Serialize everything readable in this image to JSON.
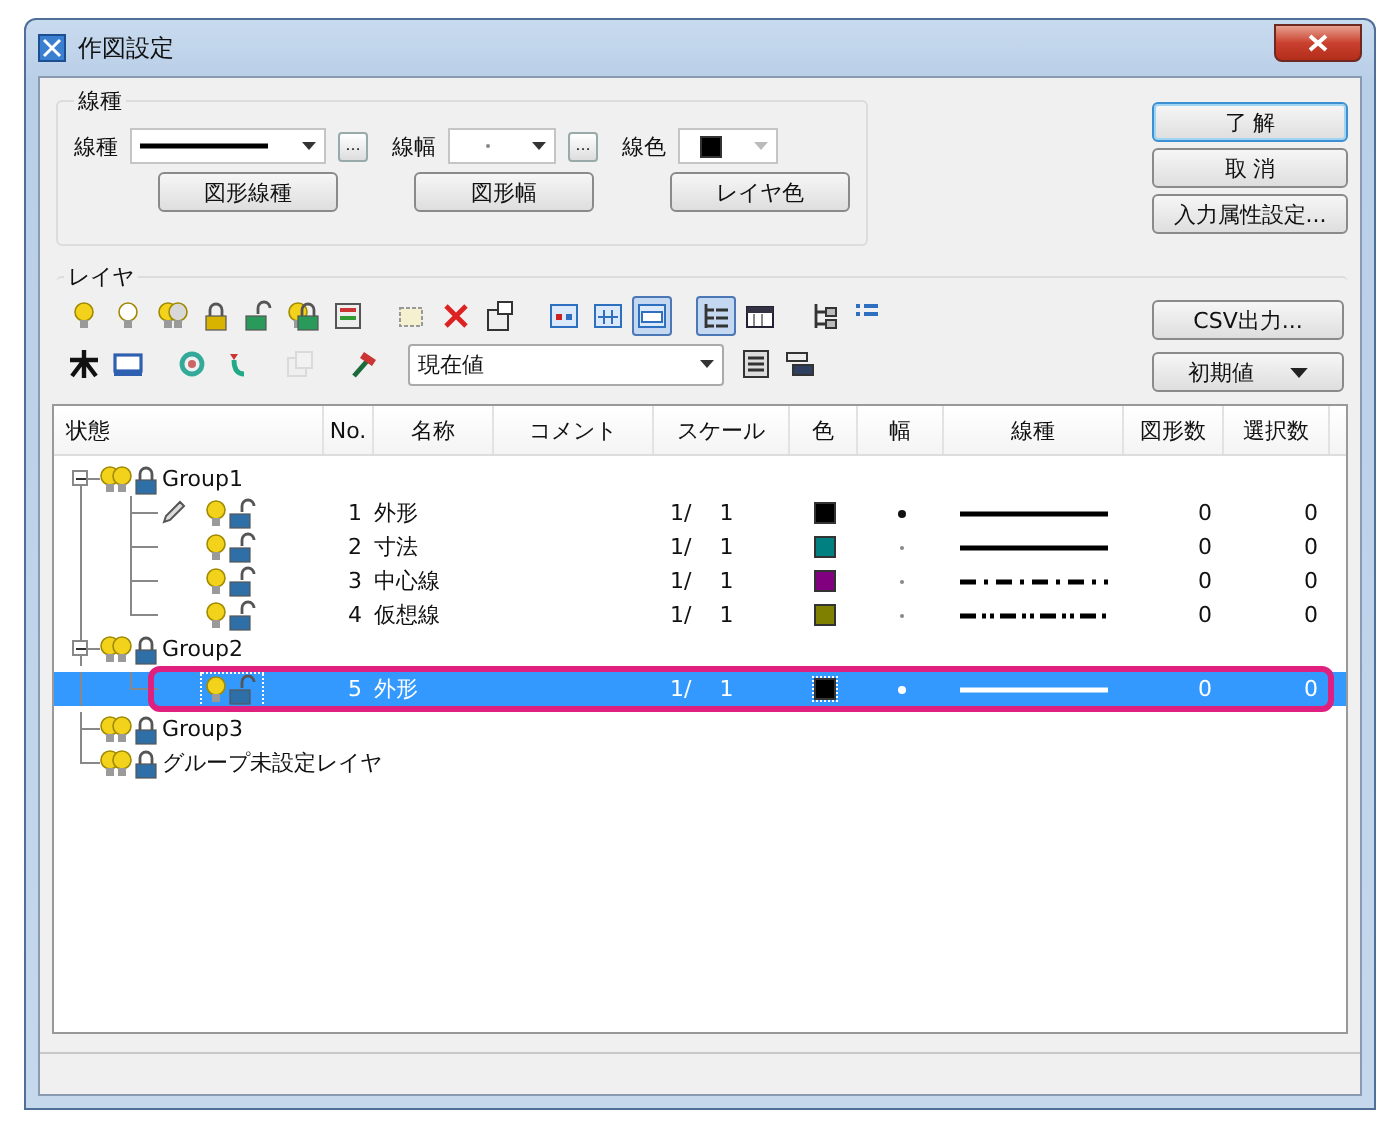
{
  "window": {
    "title": "作図設定"
  },
  "line_settings": {
    "title": "線種",
    "line_type": {
      "label": "線種",
      "line": {
        "kind": "solid"
      },
      "more": "…"
    },
    "line_width": {
      "label": "線幅",
      "width": {
        "kind": "thin"
      },
      "more": "…"
    },
    "line_color": {
      "label": "線色",
      "color": "#000000"
    },
    "buttons": [
      "図形線種",
      "図形幅",
      "レイヤ色"
    ]
  },
  "dialog_buttons": [
    {
      "label": "了 解",
      "default": true
    },
    {
      "label": "取 消",
      "default": false
    },
    {
      "label": "入力属性設定...",
      "default": false
    }
  ],
  "layers": {
    "title": "レイヤ",
    "toolbar_rows": [
      [
        [
          {
            "kind": "bulb-on",
            "pressed": false,
            "disabled": false
          },
          {
            "kind": "bulb-off",
            "pressed": false,
            "disabled": false
          },
          {
            "kind": "bulbs",
            "pressed": false,
            "disabled": false
          },
          {
            "kind": "lock",
            "pressed": false,
            "disabled": false
          },
          {
            "kind": "unlock",
            "pressed": false,
            "disabled": false
          },
          {
            "kind": "lock-group",
            "pressed": false,
            "disabled": false
          },
          {
            "kind": "panel",
            "pressed": false,
            "disabled": false
          }
        ],
        [
          {
            "kind": "new",
            "pressed": false,
            "disabled": false
          },
          {
            "kind": "delete",
            "pressed": false,
            "disabled": false
          },
          {
            "kind": "props",
            "pressed": false,
            "disabled": false
          }
        ],
        [
          {
            "kind": "view-a",
            "pressed": false,
            "disabled": false
          },
          {
            "kind": "view-b",
            "pressed": false,
            "disabled": false
          },
          {
            "kind": "view-c",
            "pressed": true,
            "disabled": false
          }
        ],
        [
          {
            "kind": "tree",
            "pressed": true,
            "disabled": false
          },
          {
            "kind": "list",
            "pressed": false,
            "disabled": false
          }
        ],
        [
          {
            "kind": "hier",
            "pressed": false,
            "disabled": false
          },
          {
            "kind": "bullets",
            "pressed": false,
            "disabled": false
          }
        ]
      ],
      [
        [
          {
            "kind": "asterisk",
            "pressed": false,
            "disabled": false
          },
          {
            "kind": "monitor",
            "pressed": false,
            "disabled": false
          }
        ],
        [
          {
            "kind": "swap-a",
            "pressed": false,
            "disabled": false
          },
          {
            "kind": "swap-b",
            "pressed": false,
            "disabled": false
          }
        ],
        [
          {
            "kind": "copy",
            "pressed": false,
            "disabled": true
          }
        ],
        [
          {
            "kind": "hammer",
            "pressed": false,
            "disabled": false
          }
        ],
        [
          {
            "kind": "dropdown",
            "value": "現在値"
          },
          {
            "kind": "tool-a",
            "pressed": false,
            "disabled": false
          },
          {
            "kind": "tool-b",
            "pressed": false,
            "disabled": false
          }
        ]
      ]
    ],
    "side_buttons": [
      {
        "label": "CSV出力...",
        "kind": "plain"
      },
      {
        "label": "初期値",
        "kind": "menu"
      }
    ],
    "columns": [
      "状態",
      "No.",
      "名称",
      "コメント",
      "スケール",
      "色",
      "幅",
      "線種",
      "図形数",
      "選択数"
    ],
    "tree": [
      {
        "kind": "group",
        "name": "Group1",
        "expanded": true,
        "visible": true,
        "locked": true,
        "selected": false,
        "highlighted": false,
        "children": [
          {
            "kind": "layer",
            "no": "1",
            "name": "外形",
            "current": true,
            "visible": true,
            "locked": false,
            "scale": "1/",
            "scale_value": "1",
            "color": "#000000",
            "width": {
              "kind": "thick"
            },
            "line": {
              "kind": "solid"
            },
            "shapes": "0",
            "selected_count": "0",
            "selected": false,
            "highlighted": false
          },
          {
            "kind": "layer",
            "no": "2",
            "name": "寸法",
            "current": false,
            "visible": true,
            "locked": false,
            "scale": "1/",
            "scale_value": "1",
            "color": "#008080",
            "width": {
              "kind": "thin"
            },
            "line": {
              "kind": "solid"
            },
            "shapes": "0",
            "selected_count": "0",
            "selected": false,
            "highlighted": false
          },
          {
            "kind": "layer",
            "no": "3",
            "name": "中心線",
            "current": false,
            "visible": true,
            "locked": false,
            "scale": "1/",
            "scale_value": "1",
            "color": "#800080",
            "width": {
              "kind": "thin"
            },
            "line": {
              "kind": "dashdot"
            },
            "shapes": "0",
            "selected_count": "0",
            "selected": false,
            "highlighted": false
          },
          {
            "kind": "layer",
            "no": "4",
            "name": "仮想線",
            "current": false,
            "visible": true,
            "locked": false,
            "scale": "1/",
            "scale_value": "1",
            "color": "#808000",
            "width": {
              "kind": "thin"
            },
            "line": {
              "kind": "dashdotdot"
            },
            "shapes": "0",
            "selected_count": "0",
            "selected": false,
            "highlighted": false
          }
        ]
      },
      {
        "kind": "group",
        "name": "Group2",
        "expanded": true,
        "visible": true,
        "locked": true,
        "selected": false,
        "highlighted": false,
        "children": [
          {
            "kind": "layer",
            "no": "5",
            "name": "外形",
            "current": false,
            "visible": true,
            "locked": false,
            "scale": "1/",
            "scale_value": "1",
            "color": "#000000",
            "width": {
              "kind": "thick"
            },
            "line": {
              "kind": "solid"
            },
            "shapes": "0",
            "selected_count": "0",
            "selected": true,
            "highlighted": true
          }
        ]
      },
      {
        "kind": "group",
        "name": "Group3",
        "visible": true,
        "locked": true,
        "selected": false,
        "highlighted": false
      },
      {
        "kind": "group",
        "name": "グループ未設定レイヤ",
        "visible": true,
        "locked": true,
        "selected": false,
        "highlighted": false
      }
    ]
  }
}
